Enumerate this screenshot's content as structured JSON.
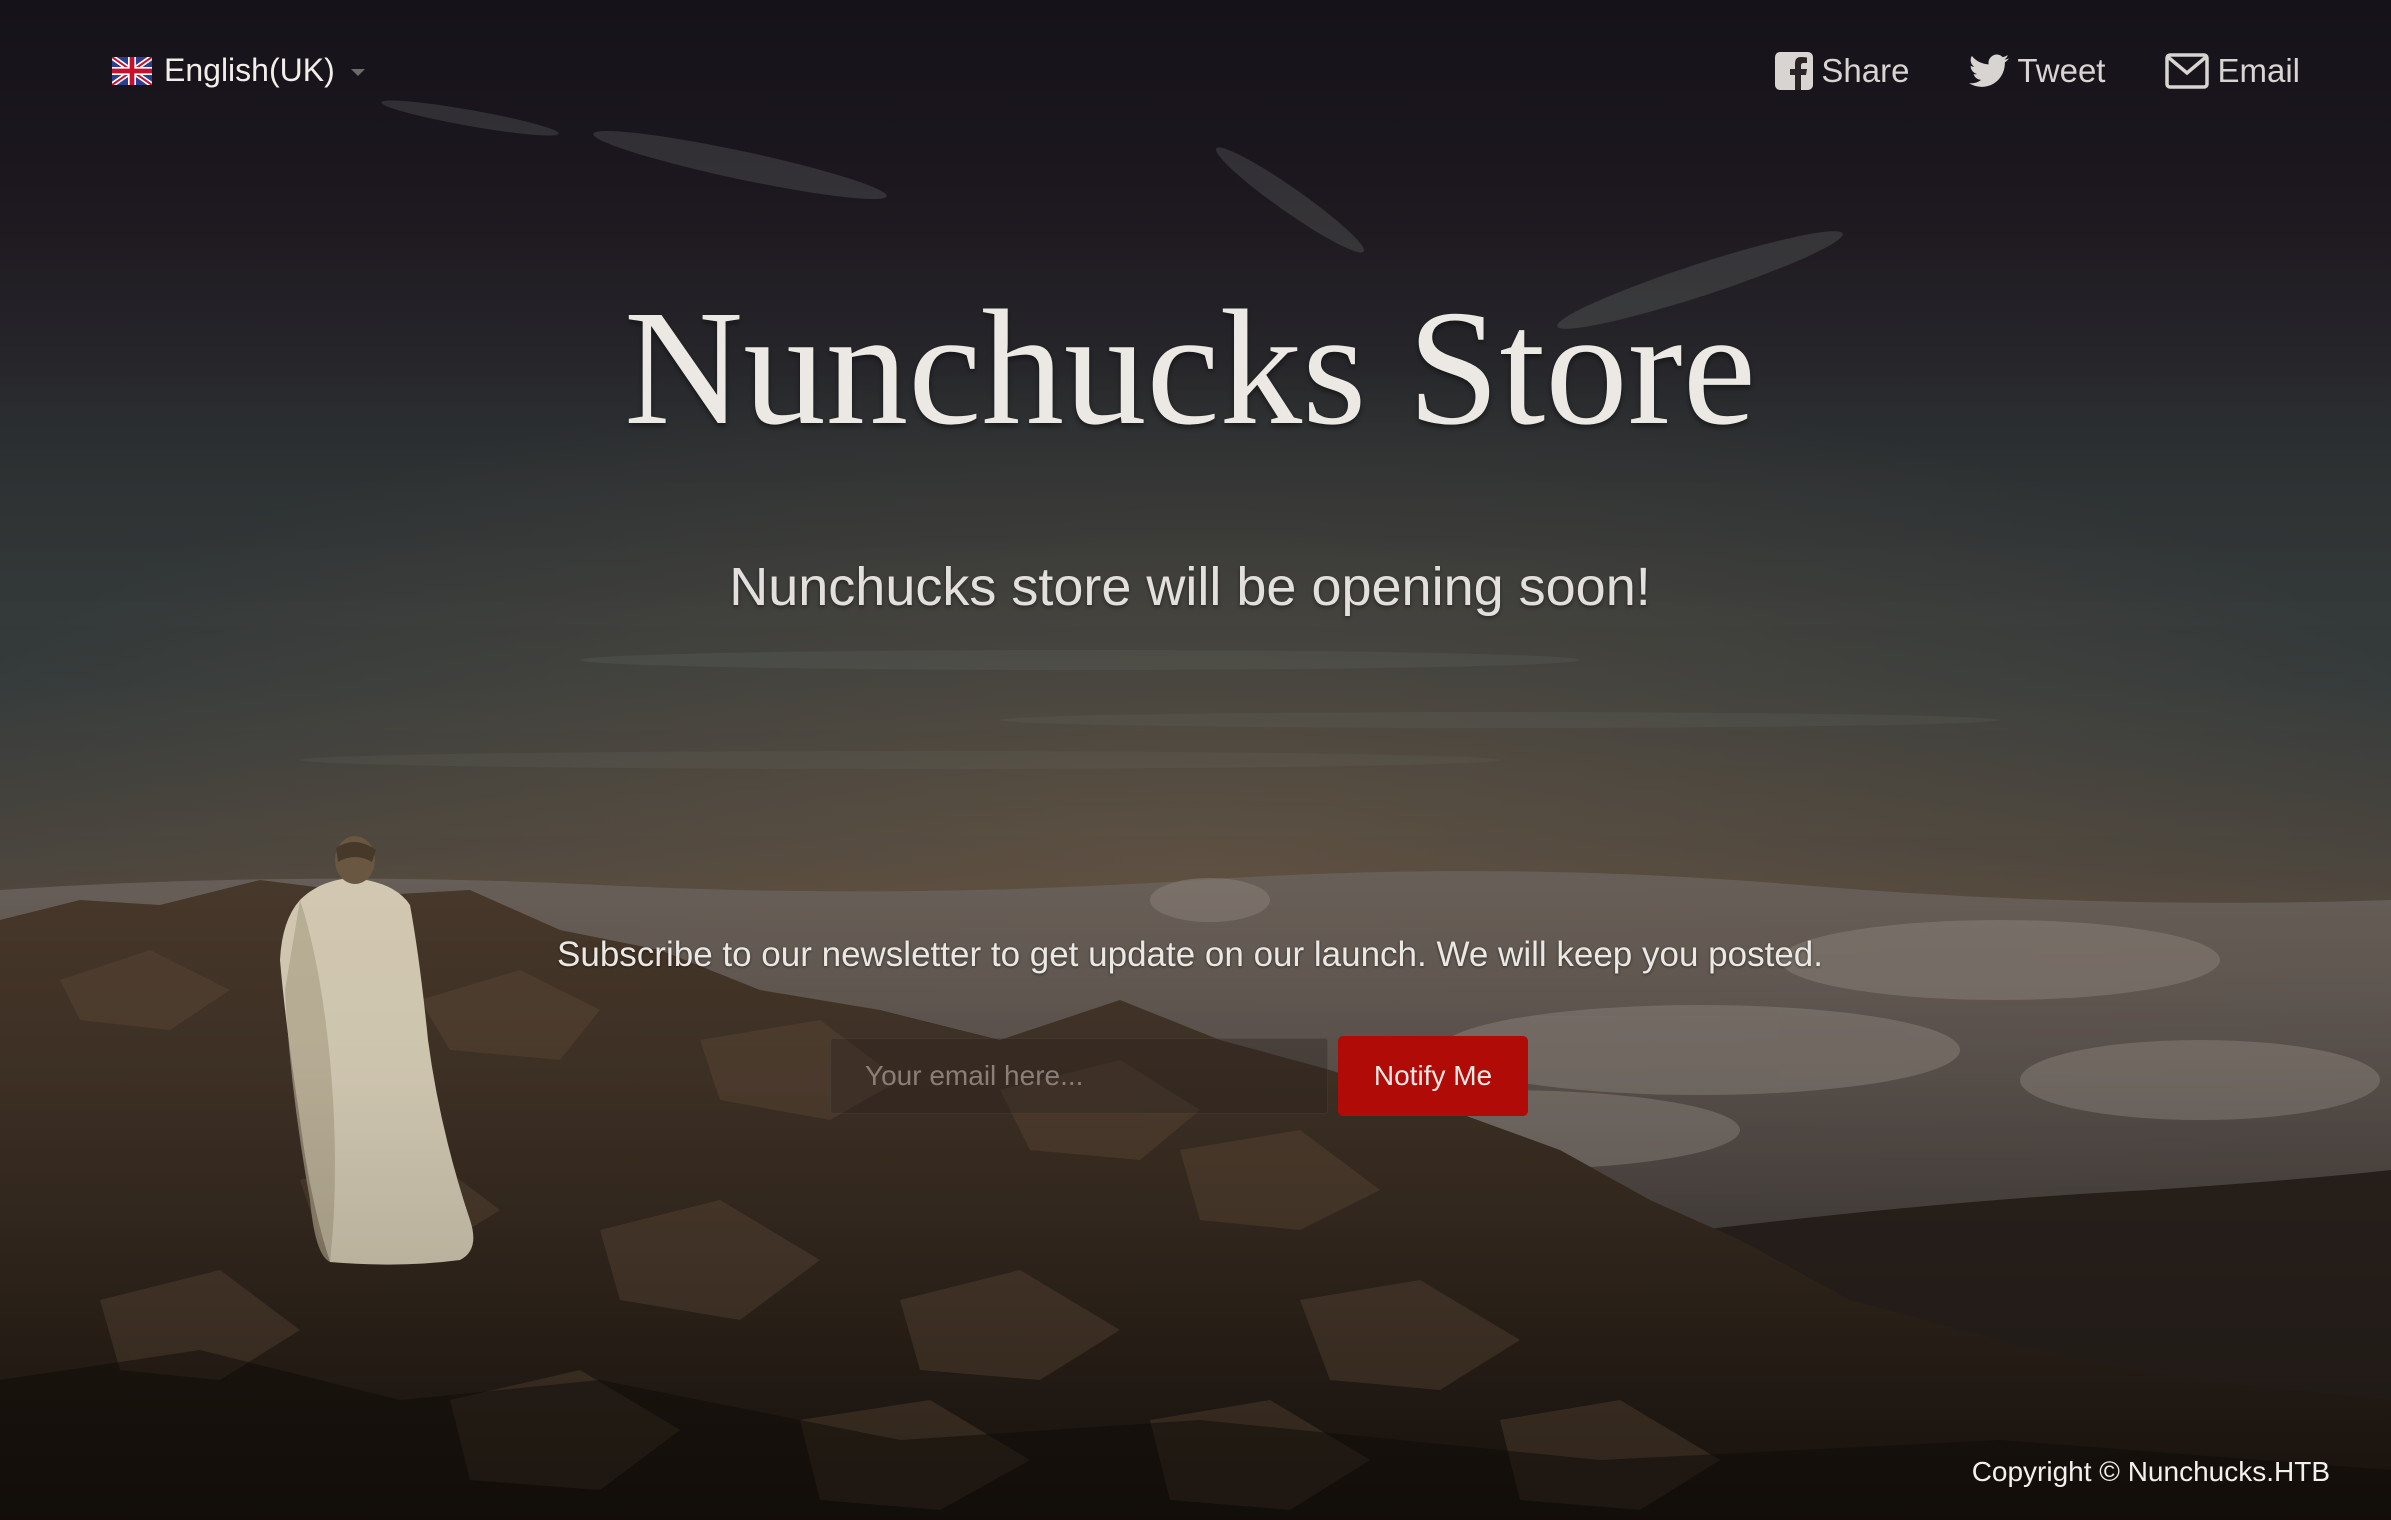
{
  "language": {
    "flag_icon": "uk-flag-icon",
    "selected": "English(UK)"
  },
  "social": {
    "share_label": "Share",
    "tweet_label": "Tweet",
    "email_label": "Email"
  },
  "hero": {
    "title": "Nunchucks Store",
    "subtitle": "Nunchucks store will be opening soon!"
  },
  "newsletter": {
    "text": "Subscribe to our newsletter to get update on our launch. We will keep you posted.",
    "email_placeholder": "Your email here...",
    "email_value": "",
    "button_label": "Notify Me"
  },
  "footer": {
    "copyright": "Copyright © Nunchucks.HTB"
  },
  "colors": {
    "button": "#b00b07",
    "sky_top": "#1b1620",
    "sky_mid": "#343c3d",
    "horizon": "#5b4b3f"
  }
}
